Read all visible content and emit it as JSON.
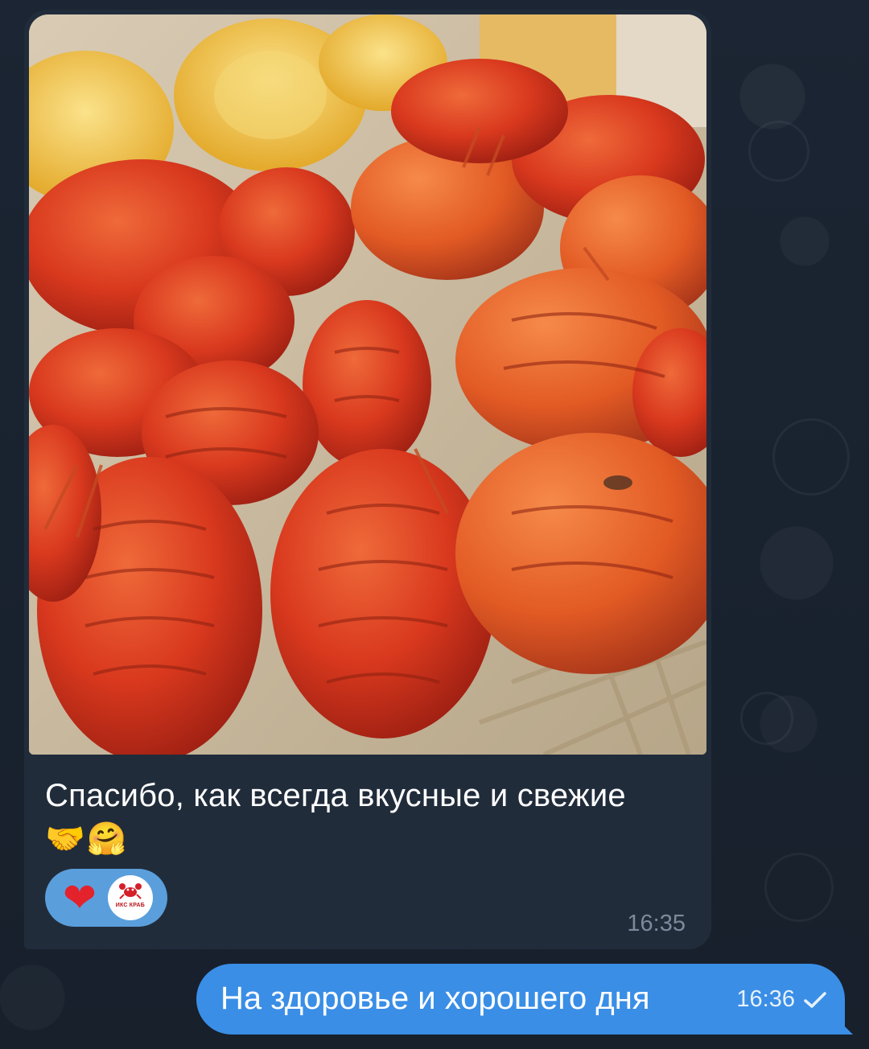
{
  "chat": {
    "incoming": {
      "caption_line1": "Спасибо, как всегда вкусные и свежие",
      "emojis": [
        "🤝",
        "🤗"
      ],
      "reactions": {
        "heart": "❤",
        "brand_label": "ИКС КРАБ"
      },
      "time": "16:35"
    },
    "outgoing": {
      "text": "На здоровье и хорошего дня",
      "time": "16:36",
      "status_icon": "single-check-icon"
    }
  },
  "colors": {
    "background": "#1a2330",
    "incoming_bubble": "#212c3b",
    "outgoing_bubble": "#3a8ee6",
    "reaction_pill": "#5a9fdc",
    "heart": "#e3222c"
  }
}
